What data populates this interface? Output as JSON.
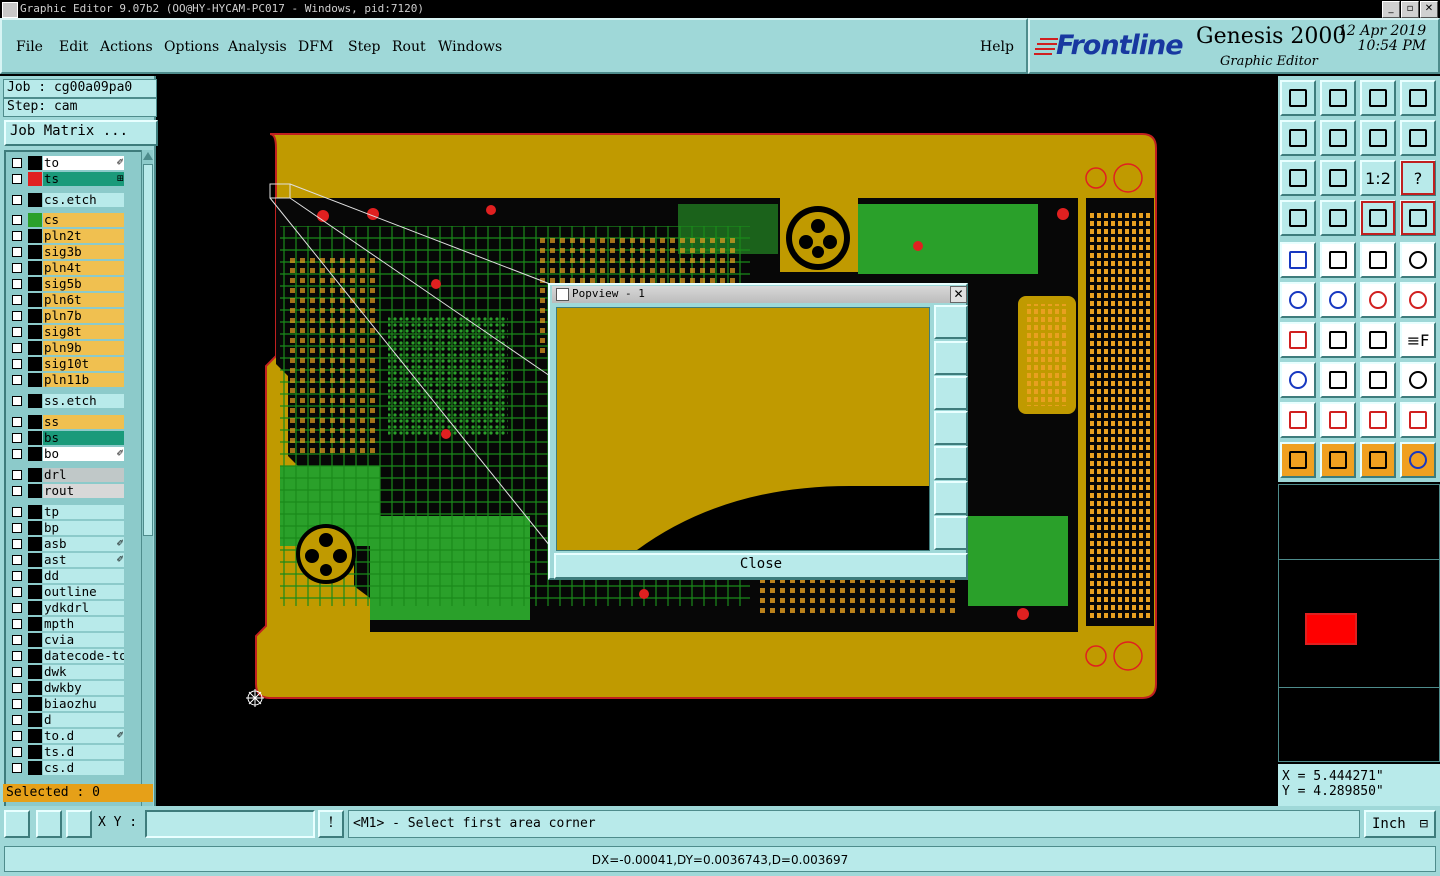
{
  "window": {
    "title": "Graphic Editor 9.07b2 (OO@HY-HYCAM-PC017 - Windows, pid:7120)"
  },
  "menu": [
    "File",
    "Edit",
    "Actions",
    "Options",
    "Analysis",
    "DFM",
    "Step",
    "Rout",
    "Windows"
  ],
  "help_label": "Help",
  "brand": {
    "logo": "Frontline",
    "product": "Genesis 2000",
    "subtitle": "Graphic Editor",
    "date": "12 Apr 2019",
    "time": "10:54 PM"
  },
  "job": {
    "job_line": "Job : cg00a09pa0",
    "step_line": "Step: cam",
    "matrix_button": "Job Matrix ..."
  },
  "layers": [
    {
      "name": "to",
      "color": "#ffffff",
      "checked": true,
      "mark": "✐"
    },
    {
      "name": "ts",
      "color": "#1a9a7a",
      "checked": true,
      "mark": "⊞",
      "swatch": "#e02020"
    },
    {
      "name": "cs.etch",
      "color": "#b8eaea",
      "checked": false
    },
    {
      "name": "cs",
      "color": "#f0c050",
      "checked": false,
      "swatch": "#2aa02a"
    },
    {
      "name": "pln2t",
      "color": "#f0c050",
      "checked": false
    },
    {
      "name": "sig3b",
      "color": "#f0c050",
      "checked": false
    },
    {
      "name": "pln4t",
      "color": "#f0c050",
      "checked": false
    },
    {
      "name": "sig5b",
      "color": "#f0c050",
      "checked": false
    },
    {
      "name": "pln6t",
      "color": "#f0c050",
      "checked": false
    },
    {
      "name": "pln7b",
      "color": "#f0c050",
      "checked": false
    },
    {
      "name": "sig8t",
      "color": "#f0c050",
      "checked": false
    },
    {
      "name": "pln9b",
      "color": "#f0c050",
      "checked": false
    },
    {
      "name": "sig10t",
      "color": "#f0c050",
      "checked": false
    },
    {
      "name": "pln11b",
      "color": "#f0c050",
      "checked": false
    },
    {
      "name": "ss.etch",
      "color": "#b8eaea",
      "checked": false
    },
    {
      "name": "ss",
      "color": "#f0c050",
      "checked": false
    },
    {
      "name": "bs",
      "color": "#1a9a7a",
      "checked": false
    },
    {
      "name": "bo",
      "color": "#ffffff",
      "checked": false,
      "mark": "✐"
    },
    {
      "name": "drl",
      "color": "#c0c8c8",
      "checked": false
    },
    {
      "name": "rout",
      "color": "#d8d8d8",
      "checked": false
    },
    {
      "name": "tp",
      "color": "#b8eaea",
      "checked": false
    },
    {
      "name": "bp",
      "color": "#b8eaea",
      "checked": false
    },
    {
      "name": "asb",
      "color": "#b8eaea",
      "checked": false,
      "mark": "✐"
    },
    {
      "name": "ast",
      "color": "#b8eaea",
      "checked": false,
      "mark": "✐"
    },
    {
      "name": "dd",
      "color": "#b8eaea",
      "checked": false
    },
    {
      "name": "outline",
      "color": "#b8eaea",
      "checked": false
    },
    {
      "name": "ydkdrl",
      "color": "#b8eaea",
      "checked": false
    },
    {
      "name": "mpth",
      "color": "#b8eaea",
      "checked": false
    },
    {
      "name": "cvia",
      "color": "#b8eaea",
      "checked": false
    },
    {
      "name": "datecode-to",
      "color": "#b8eaea",
      "checked": false
    },
    {
      "name": "dwk",
      "color": "#b8eaea",
      "checked": false
    },
    {
      "name": "dwkby",
      "color": "#b8eaea",
      "checked": false
    },
    {
      "name": "biaozhu",
      "color": "#b8eaea",
      "checked": false
    },
    {
      "name": "d",
      "color": "#b8eaea",
      "checked": false
    },
    {
      "name": "to.d",
      "color": "#b8eaea",
      "checked": false,
      "mark": "✐"
    },
    {
      "name": "ts.d",
      "color": "#b8eaea",
      "checked": false
    },
    {
      "name": "cs.d",
      "color": "#b8eaea",
      "checked": false
    }
  ],
  "selected": "Selected : 0",
  "popview": {
    "title": "Popview - 1",
    "close_label": "Close",
    "close_x": "✕"
  },
  "toolbar_icons": [
    [
      "home-up-icon",
      "home-down-icon",
      "home-house-icon",
      "split-view-icon"
    ],
    [
      "arrow-left-icon",
      "arrow-right-icon",
      "swap-icon",
      "s-curve-icon"
    ],
    [
      "fit-frame-icon",
      "center-icon",
      "scale-1to2-icon",
      "help-question-icon"
    ],
    [
      "edit-tool-icon",
      "grid-icon",
      "traffic-light-icon",
      "traffic-light-alt-icon"
    ],
    [
      "add-pad-icon",
      "draw-line-icon",
      "measure-ruler-icon",
      "circle-dot-icon"
    ],
    [
      "connect-nodes-icon",
      "cross-node-icon",
      "move-node-icon",
      "snap-node-icon"
    ],
    [
      "angle-icon",
      "slash-line-icon",
      "arc-icon",
      "ff-icon"
    ],
    [
      "pad-node-icon",
      "h-line-icon",
      "dimension-icon",
      "blob-icon"
    ],
    [
      "triangle-a-icon",
      "triangle-b-icon",
      "triangle-c-icon",
      "triangle-d-icon"
    ],
    [
      "pointer-icon",
      "pointer-box-icon",
      "pointer-alt-icon",
      "node-route-icon"
    ]
  ],
  "toolbar_labels": {
    "scale": "1:2",
    "help": "?",
    "ff": "≡F"
  },
  "coords": {
    "x": "X = 5.444271\"",
    "y": "Y = 4.289850\""
  },
  "bottom": {
    "xy_label": "X Y :",
    "xy_value": "",
    "prompt": "<M1> - Select first area corner",
    "unit": "Inch",
    "excl": "!"
  },
  "status": "DX=-0.00041,DY=0.0036743,D=0.003697"
}
